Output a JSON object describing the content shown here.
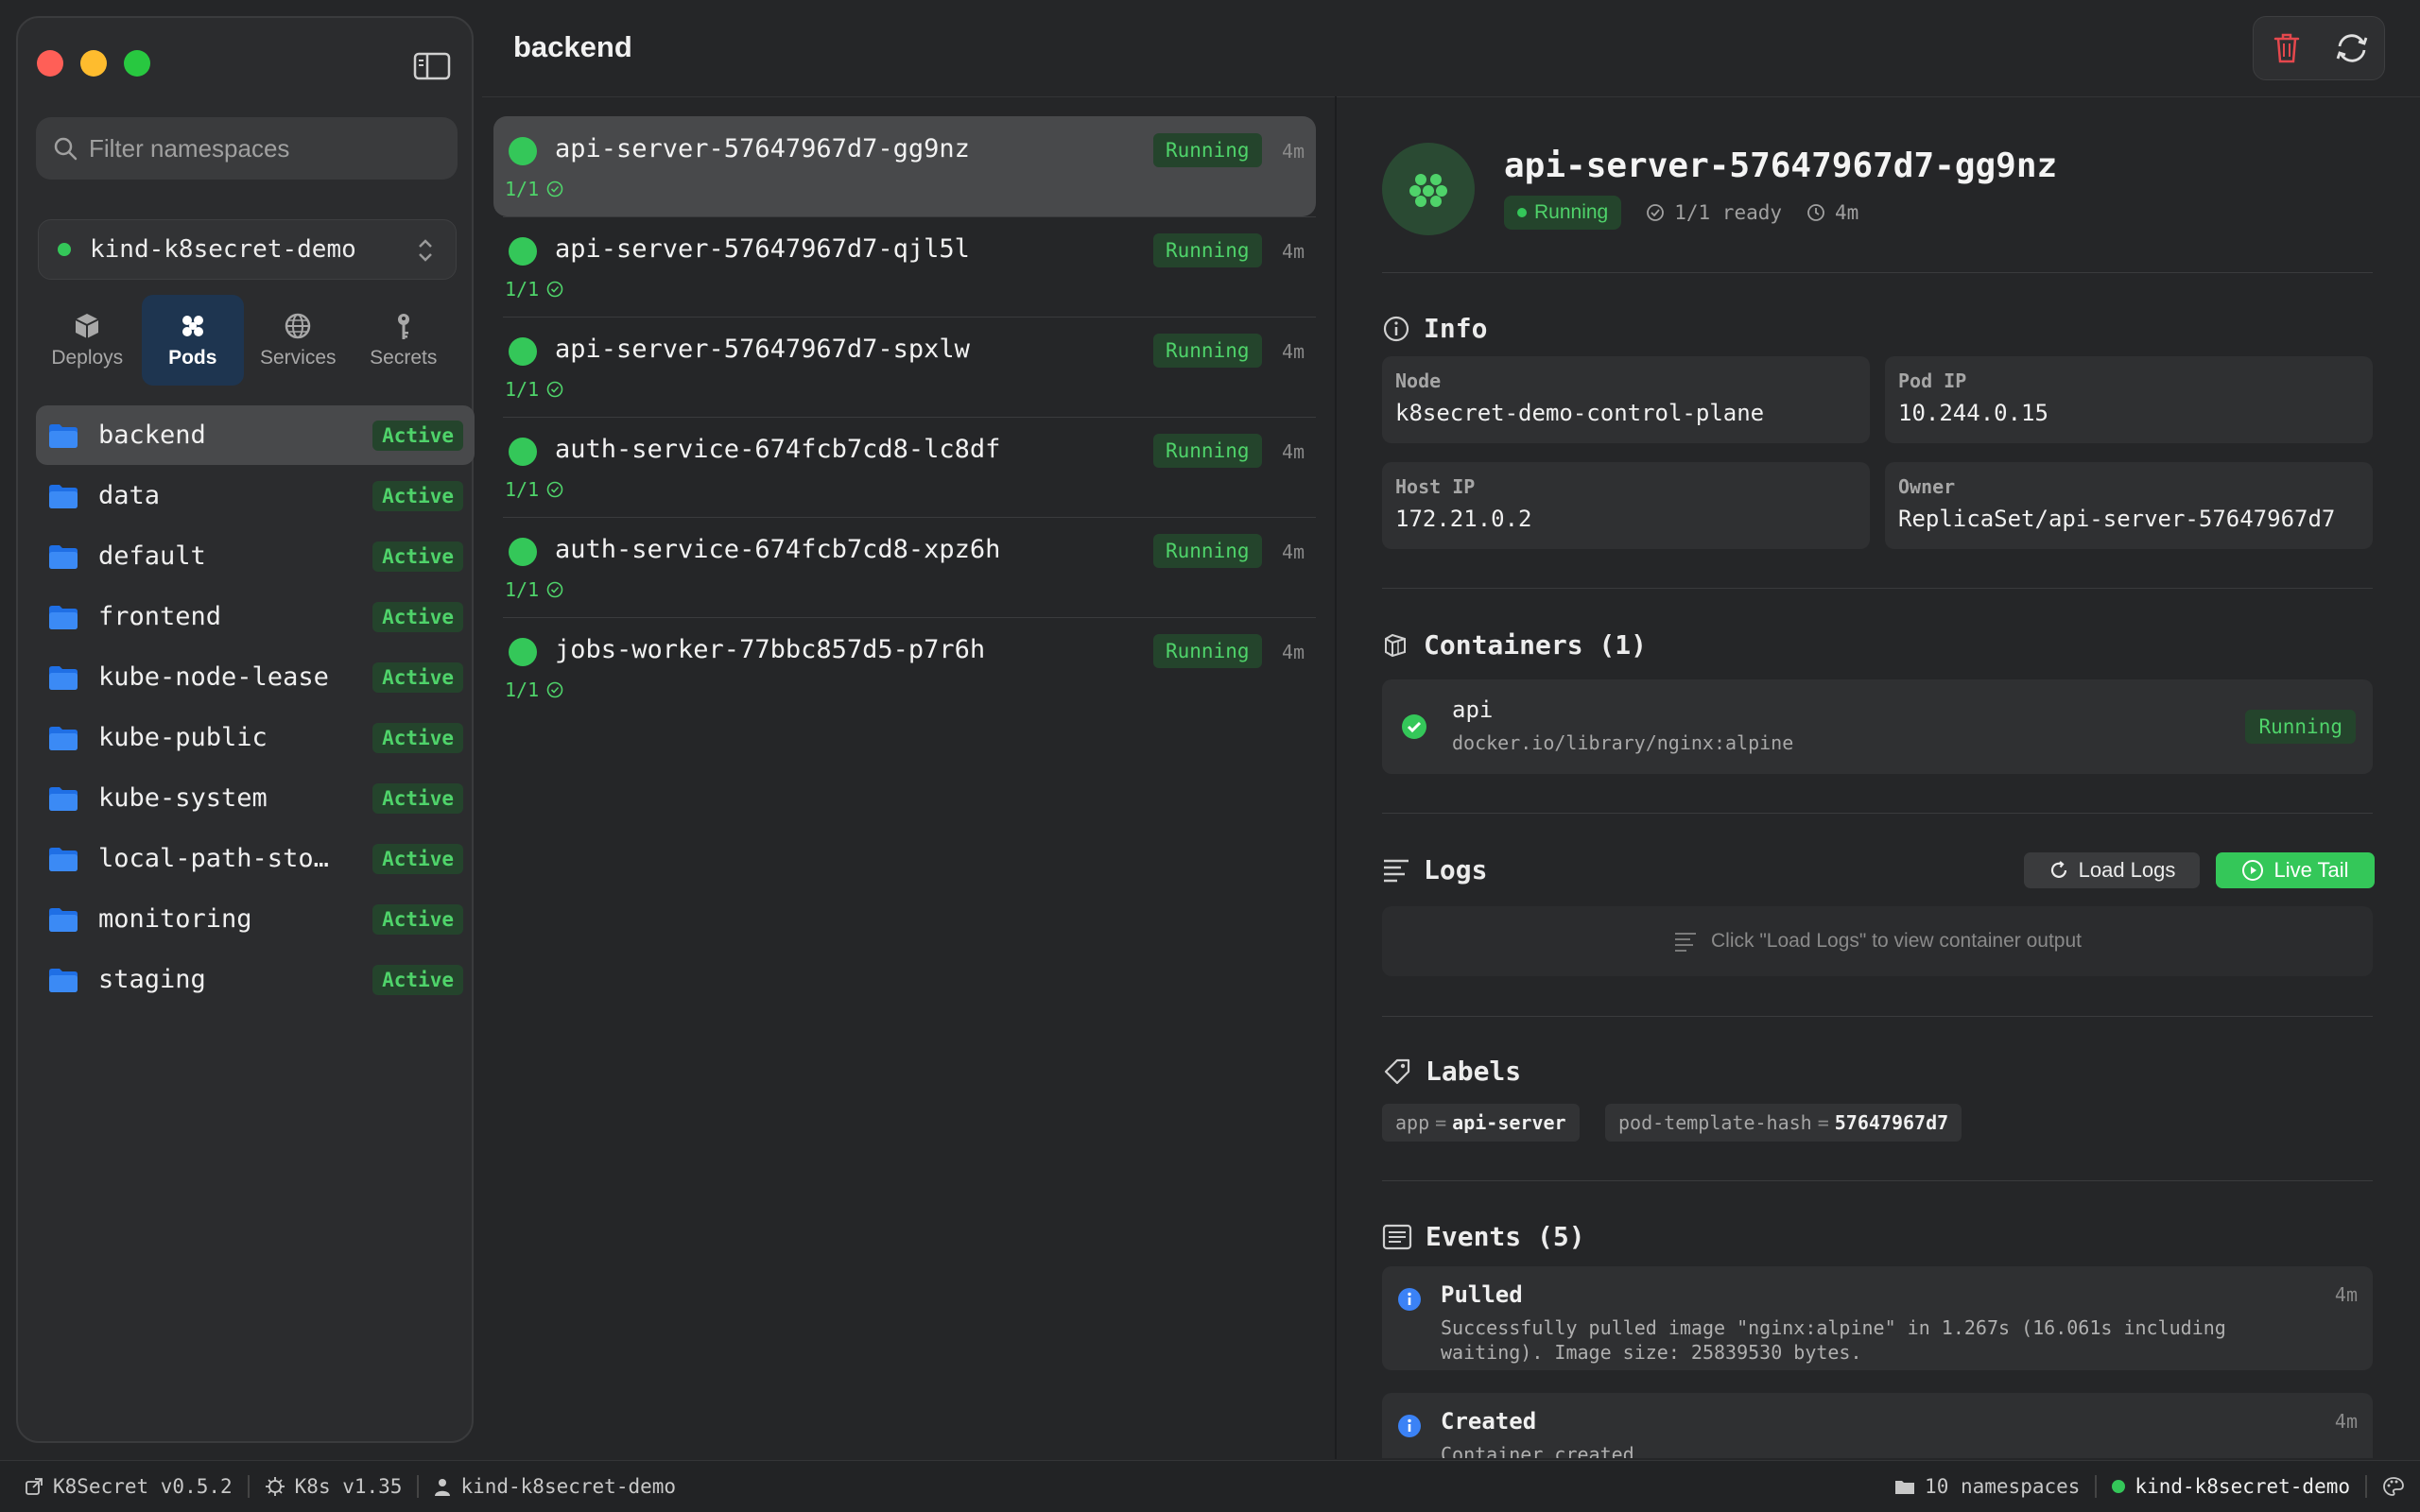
{
  "window": {
    "title": "backend"
  },
  "sidebar": {
    "filter_placeholder": "Filter namespaces",
    "context": "kind-k8secret-demo",
    "tabs": [
      {
        "label": "Deploys",
        "icon": "cube-icon"
      },
      {
        "label": "Pods",
        "icon": "pods-icon"
      },
      {
        "label": "Services",
        "icon": "globe-icon"
      },
      {
        "label": "Secrets",
        "icon": "key-icon"
      }
    ],
    "active_tab": "Pods",
    "namespaces": [
      {
        "name": "backend",
        "status": "Active"
      },
      {
        "name": "data",
        "status": "Active"
      },
      {
        "name": "default",
        "status": "Active"
      },
      {
        "name": "frontend",
        "status": "Active"
      },
      {
        "name": "kube-node-lease",
        "status": "Active"
      },
      {
        "name": "kube-public",
        "status": "Active"
      },
      {
        "name": "kube-system",
        "status": "Active"
      },
      {
        "name": "local-path-sto…",
        "status": "Active"
      },
      {
        "name": "monitoring",
        "status": "Active"
      },
      {
        "name": "staging",
        "status": "Active"
      }
    ]
  },
  "pods": [
    {
      "name": "api-server-57647967d7-gg9nz",
      "ready": "1/1",
      "status": "Running",
      "age": "4m"
    },
    {
      "name": "api-server-57647967d7-qjl5l",
      "ready": "1/1",
      "status": "Running",
      "age": "4m"
    },
    {
      "name": "api-server-57647967d7-spxlw",
      "ready": "1/1",
      "status": "Running",
      "age": "4m"
    },
    {
      "name": "auth-service-674fcb7cd8-lc8df",
      "ready": "1/1",
      "status": "Running",
      "age": "4m"
    },
    {
      "name": "auth-service-674fcb7cd8-xpz6h",
      "ready": "1/1",
      "status": "Running",
      "age": "4m"
    },
    {
      "name": "jobs-worker-77bbc857d5-p7r6h",
      "ready": "1/1",
      "status": "Running",
      "age": "4m"
    }
  ],
  "detail": {
    "title": "api-server-57647967d7-gg9nz",
    "status": "Running",
    "ready": "1/1 ready",
    "age": "4m",
    "info_title": "Info",
    "info": {
      "node_label": "Node",
      "node": "k8secret-demo-control-plane",
      "podip_label": "Pod IP",
      "podip": "10.244.0.15",
      "hostip_label": "Host IP",
      "hostip": "172.21.0.2",
      "owner_label": "Owner",
      "owner": "ReplicaSet/api-server-57647967d7"
    },
    "containers_title": "Containers (1)",
    "container": {
      "name": "api",
      "image": "docker.io/library/nginx:alpine",
      "status": "Running"
    },
    "logs_title": "Logs",
    "load_logs": "Load Logs",
    "live_tail": "Live Tail",
    "logs_placeholder": "Click \"Load Logs\" to view container output",
    "labels_title": "Labels",
    "labels": [
      {
        "key": "app",
        "eq": "=",
        "value": "api-server"
      },
      {
        "key": "pod-template-hash",
        "eq": "=",
        "value": "57647967d7"
      }
    ],
    "events_title": "Events (5)",
    "events": [
      {
        "title": "Pulled",
        "message": "Successfully pulled image \"nginx:alpine\" in 1.267s (16.061s including waiting). Image size: 25839530 bytes.",
        "age": "4m"
      },
      {
        "title": "Created",
        "message": "Container created",
        "age": "4m"
      }
    ]
  },
  "statusbar": {
    "app_version": "K8Secret v0.5.2",
    "k8s_version": "K8s v1.35",
    "user": "kind-k8secret-demo",
    "namespace_count": "10 namespaces",
    "context": "kind-k8secret-demo"
  },
  "colors": {
    "accent_green": "#34c759",
    "folder_blue": "#1f6fe5",
    "danger_red": "#e5484d",
    "info_blue": "#3b82f6"
  }
}
